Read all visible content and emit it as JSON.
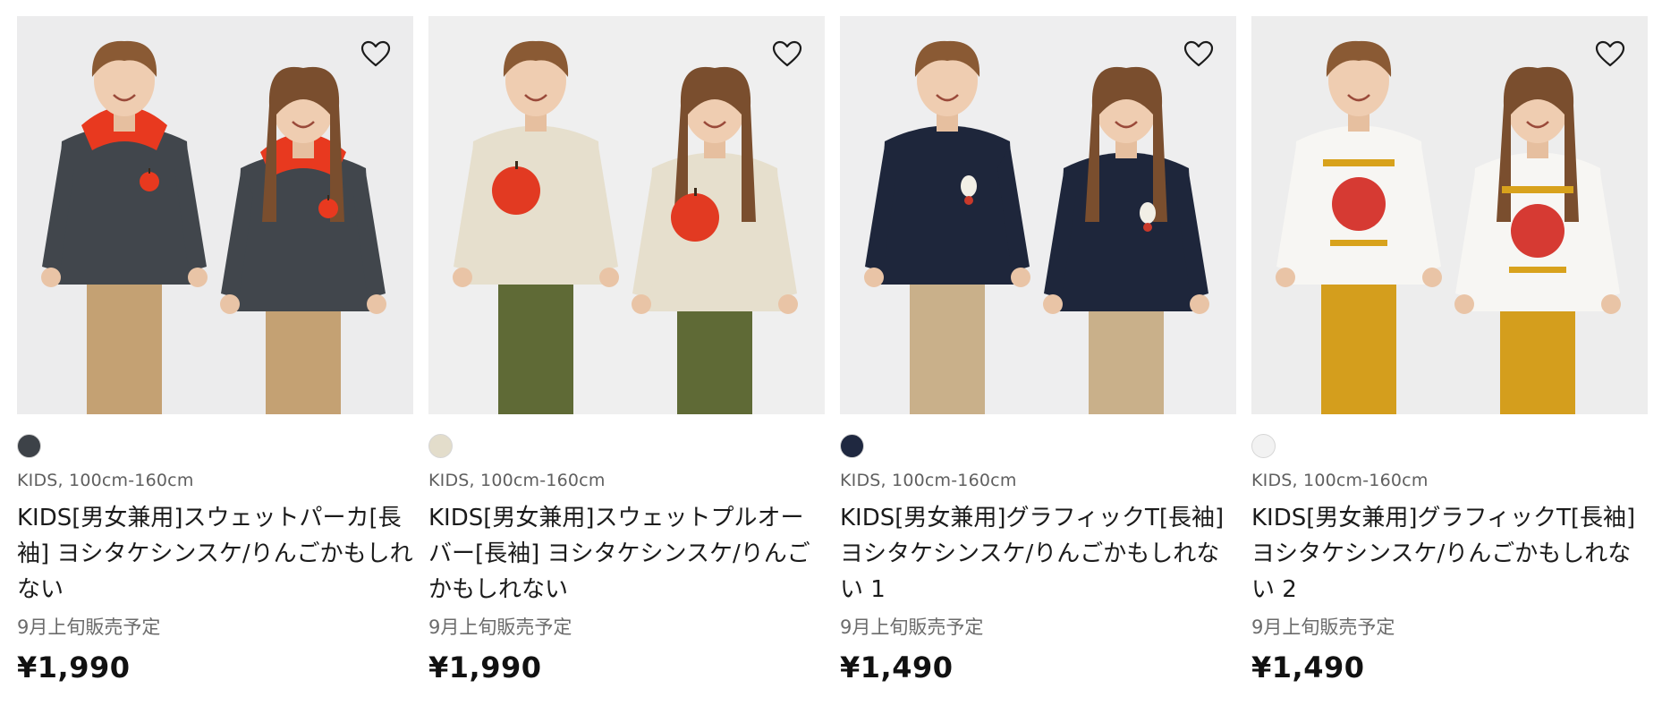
{
  "products": [
    {
      "category": "KIDS, 100cm-160cm",
      "title": "KIDS[男女兼用]スウェットパーカ[長袖] ヨシタケシンスケ/りんごかもしれない",
      "note": "9月上旬販売予定",
      "price": "¥1,990",
      "swatch_color": "#3d4248",
      "photo_bg": "#ececed",
      "garment_color": "#41464c",
      "accent_color": "#e8391f",
      "pants_color": "#c4a173",
      "graphic": "apple-small"
    },
    {
      "category": "KIDS, 100cm-160cm",
      "title": "KIDS[男女兼用]スウェットプルオーバー[長袖] ヨシタケシンスケ/りんごかもしれない",
      "note": "9月上旬販売予定",
      "price": "¥1,990",
      "swatch_color": "#e3ddcb",
      "photo_bg": "#efefef",
      "garment_color": "#e6dfcd",
      "accent_color": "#e23a22",
      "pants_color": "#5f6a36",
      "graphic": "apple-big"
    },
    {
      "category": "KIDS, 100cm-160cm",
      "title": "KIDS[男女兼用]グラフィックT[長袖] ヨシタケシンスケ/りんごかもしれない 1",
      "note": "9月上旬販売予定",
      "price": "¥1,490",
      "swatch_color": "#1f2840",
      "photo_bg": "#eeeeef",
      "garment_color": "#1e263b",
      "accent_color": "#1a7a5c",
      "pants_color": "#c9b08a",
      "graphic": "small-print"
    },
    {
      "category": "KIDS, 100cm-160cm",
      "title": "KIDS[男女兼用]グラフィックT[長袖] ヨシタケシンスケ/りんごかもしれない 2",
      "note": "9月上旬販売予定",
      "price": "¥1,490",
      "swatch_color": "#f2f2f2",
      "photo_bg": "#ededed",
      "garment_color": "#f7f6f3",
      "accent_color": "#d8a21c",
      "pants_color": "#d49e1d",
      "graphic": "big-print"
    }
  ]
}
